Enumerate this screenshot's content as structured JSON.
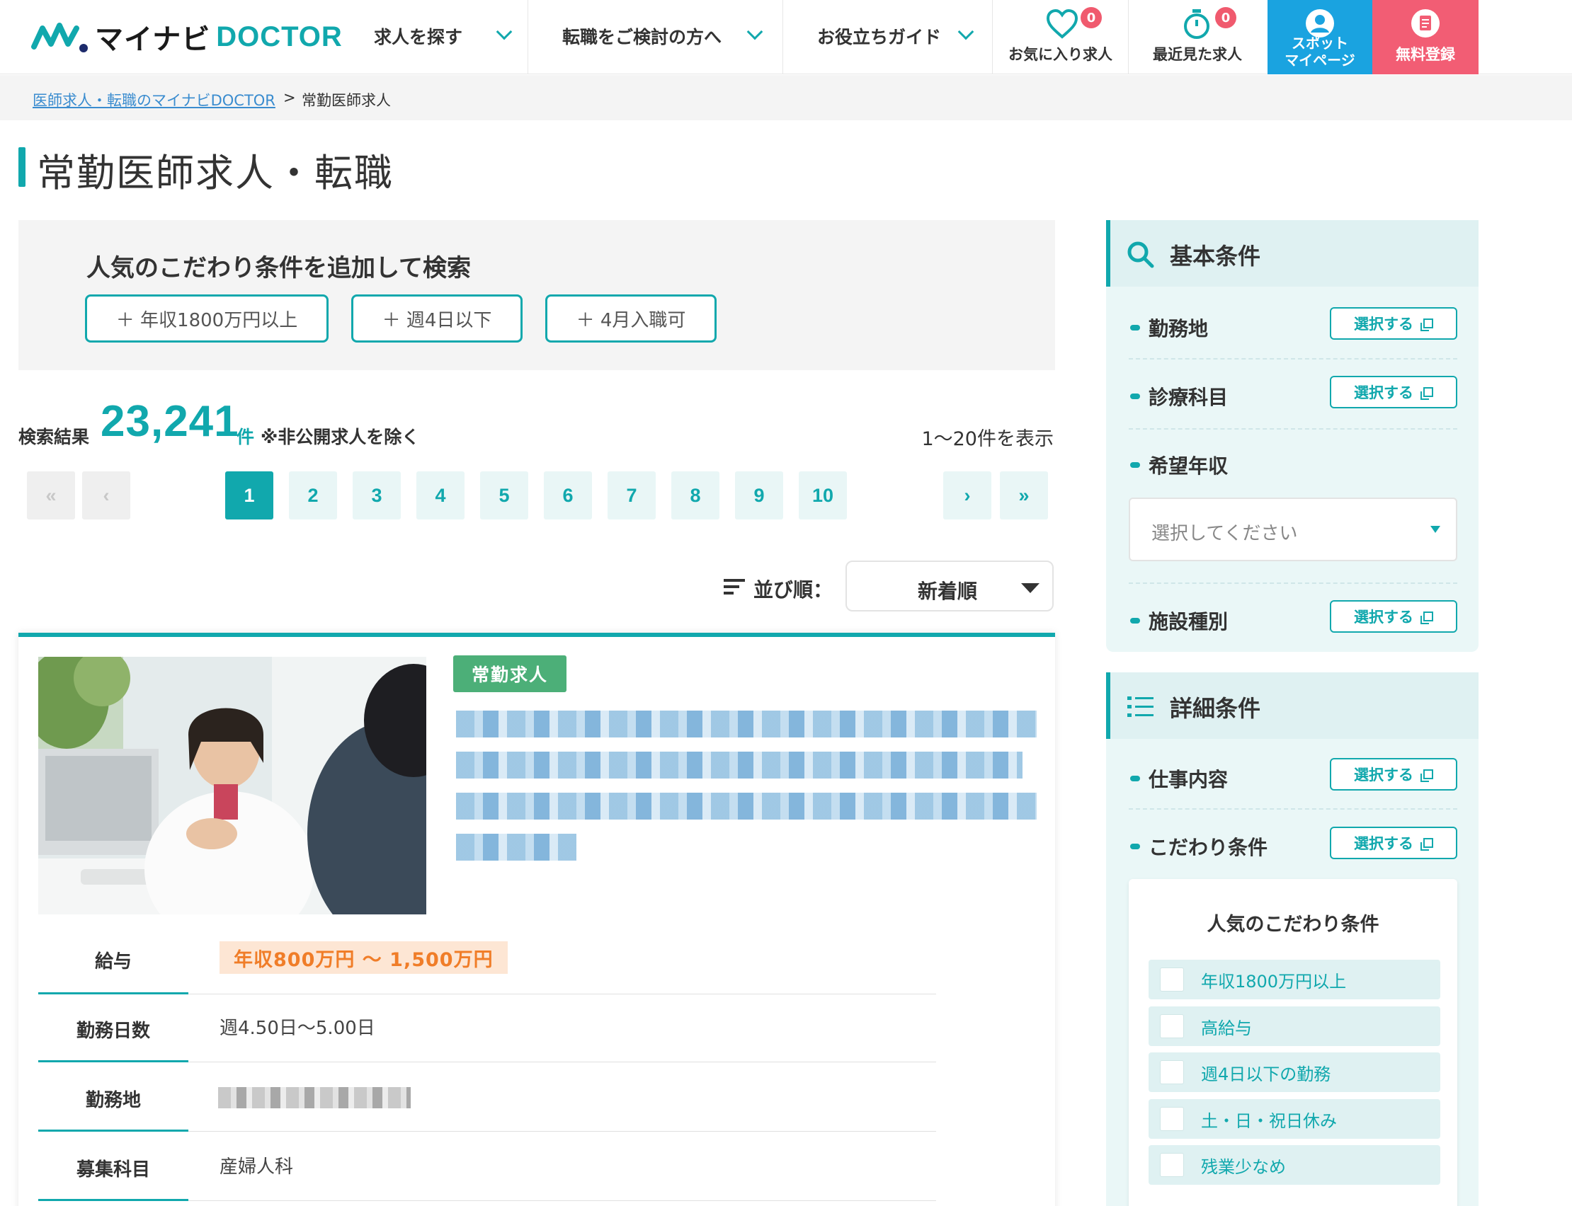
{
  "header": {
    "logo_ja": "マイナビ",
    "logo_en": "DOCTOR",
    "nav": [
      {
        "label": "求人を探す"
      },
      {
        "label": "転職をご検討の方へ"
      },
      {
        "label": "お役立ちガイド"
      }
    ],
    "favorites": {
      "label": "お気に入り求人",
      "count": "0",
      "icon": "heart-icon"
    },
    "recent": {
      "label": "最近見た求人",
      "count": "0",
      "icon": "stopwatch-icon"
    },
    "spot_line1": "スポット",
    "spot_line2": "マイページ",
    "register": "無料登録",
    "colors": {
      "accent": "#11a8ad",
      "spot": "#1aa3e0",
      "register": "#f25d74",
      "badge": "#f05a6e"
    }
  },
  "breadcrumb": {
    "home": "医師求人・転職のマイナビDOCTOR",
    "separator": ">",
    "current": "常勤医師求人"
  },
  "page_title": "常勤医師求人・転職",
  "popular": {
    "heading": "人気のこだわり条件を追加して検索",
    "chips": [
      "＋ 年収1800万円以上",
      "＋ 週4日以下",
      "＋ 4月入職可"
    ]
  },
  "results": {
    "label": "検索結果",
    "count": "23,241",
    "unit": "件",
    "note": "※非公開求人を除く",
    "range": "1〜20件を表示"
  },
  "pagination": {
    "first": "«",
    "prev": "‹",
    "pages": [
      "1",
      "2",
      "3",
      "4",
      "5",
      "6",
      "7",
      "8",
      "9",
      "10"
    ],
    "current": "1",
    "next": "›",
    "last": "»"
  },
  "sort": {
    "label": "並び順：",
    "value": "新着順"
  },
  "job": {
    "tag": "常勤求人",
    "rows": [
      {
        "label": "給与",
        "value": "年収800万円 〜 1,500万円"
      },
      {
        "label": "勤務日数",
        "value": "週4.50日〜5.00日"
      },
      {
        "label": "勤務地",
        "value": ""
      },
      {
        "label": "募集科目",
        "value": "産婦人科"
      }
    ]
  },
  "sidebar": {
    "basic": {
      "title": "基本条件",
      "items": [
        {
          "label": "勤務地",
          "button": "選択する"
        },
        {
          "label": "診療科目",
          "button": "選択する"
        },
        {
          "label": "希望年収",
          "placeholder": "選択してください"
        },
        {
          "label": "施設種別",
          "button": "選択する"
        }
      ]
    },
    "detail": {
      "title": "詳細条件",
      "items": [
        {
          "label": "仕事内容",
          "button": "選択する"
        },
        {
          "label": "こだわり条件",
          "button": "選択する"
        }
      ],
      "popular_title": "人気のこだわり条件",
      "checkboxes": [
        "年収1800万円以上",
        "高給与",
        "週4日以下の勤務",
        "土・日・祝日休み",
        "残業少なめ"
      ]
    }
  }
}
